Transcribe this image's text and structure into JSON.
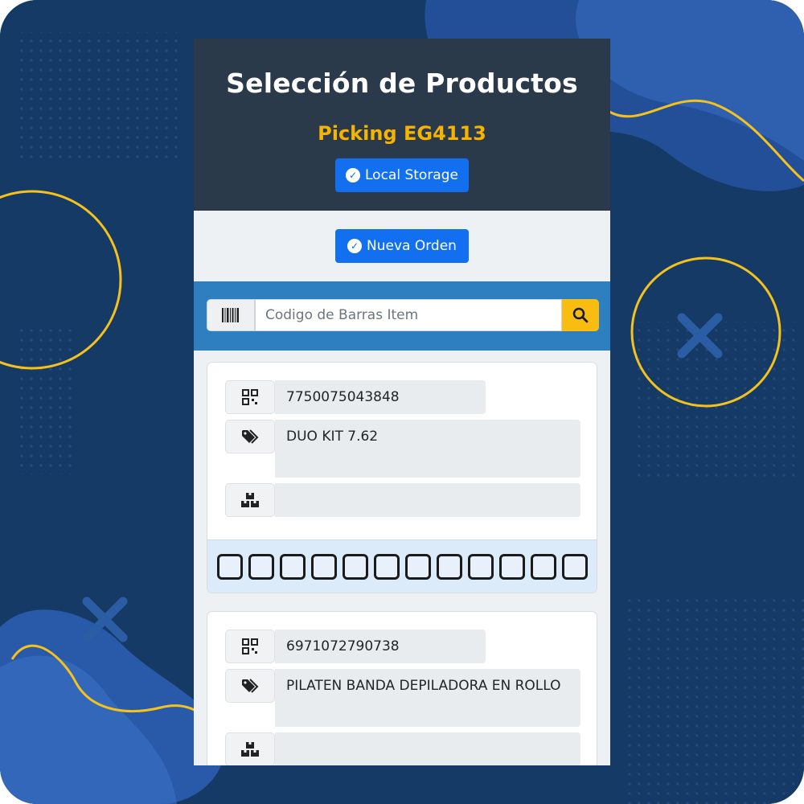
{
  "header": {
    "title": "Selección de Productos",
    "subtitle": "Picking EG4113",
    "local_storage_label": "Local Storage"
  },
  "actions": {
    "new_order_label": "Nueva Orden"
  },
  "search": {
    "placeholder": "Codigo de Barras Item",
    "value": ""
  },
  "products": [
    {
      "barcode": "7750075043848",
      "name": "DUO KIT 7.62",
      "quantity": "",
      "boxes": 12
    },
    {
      "barcode": "6971072790738",
      "name": "PILATEN BANDA DEPILADORA EN ROLLO",
      "quantity": ""
    }
  ],
  "icons": {
    "check": "check-circle-icon",
    "barcode": "barcode-icon",
    "search": "search-icon",
    "qrcode": "qrcode-icon",
    "tag": "tags-icon",
    "boxes": "boxes-icon"
  },
  "colors": {
    "background": "#163a66",
    "header": "#2b3a4a",
    "primary_button": "#1270f0",
    "accent_yellow": "#f5b400",
    "search_bar": "#2e7fc0"
  }
}
